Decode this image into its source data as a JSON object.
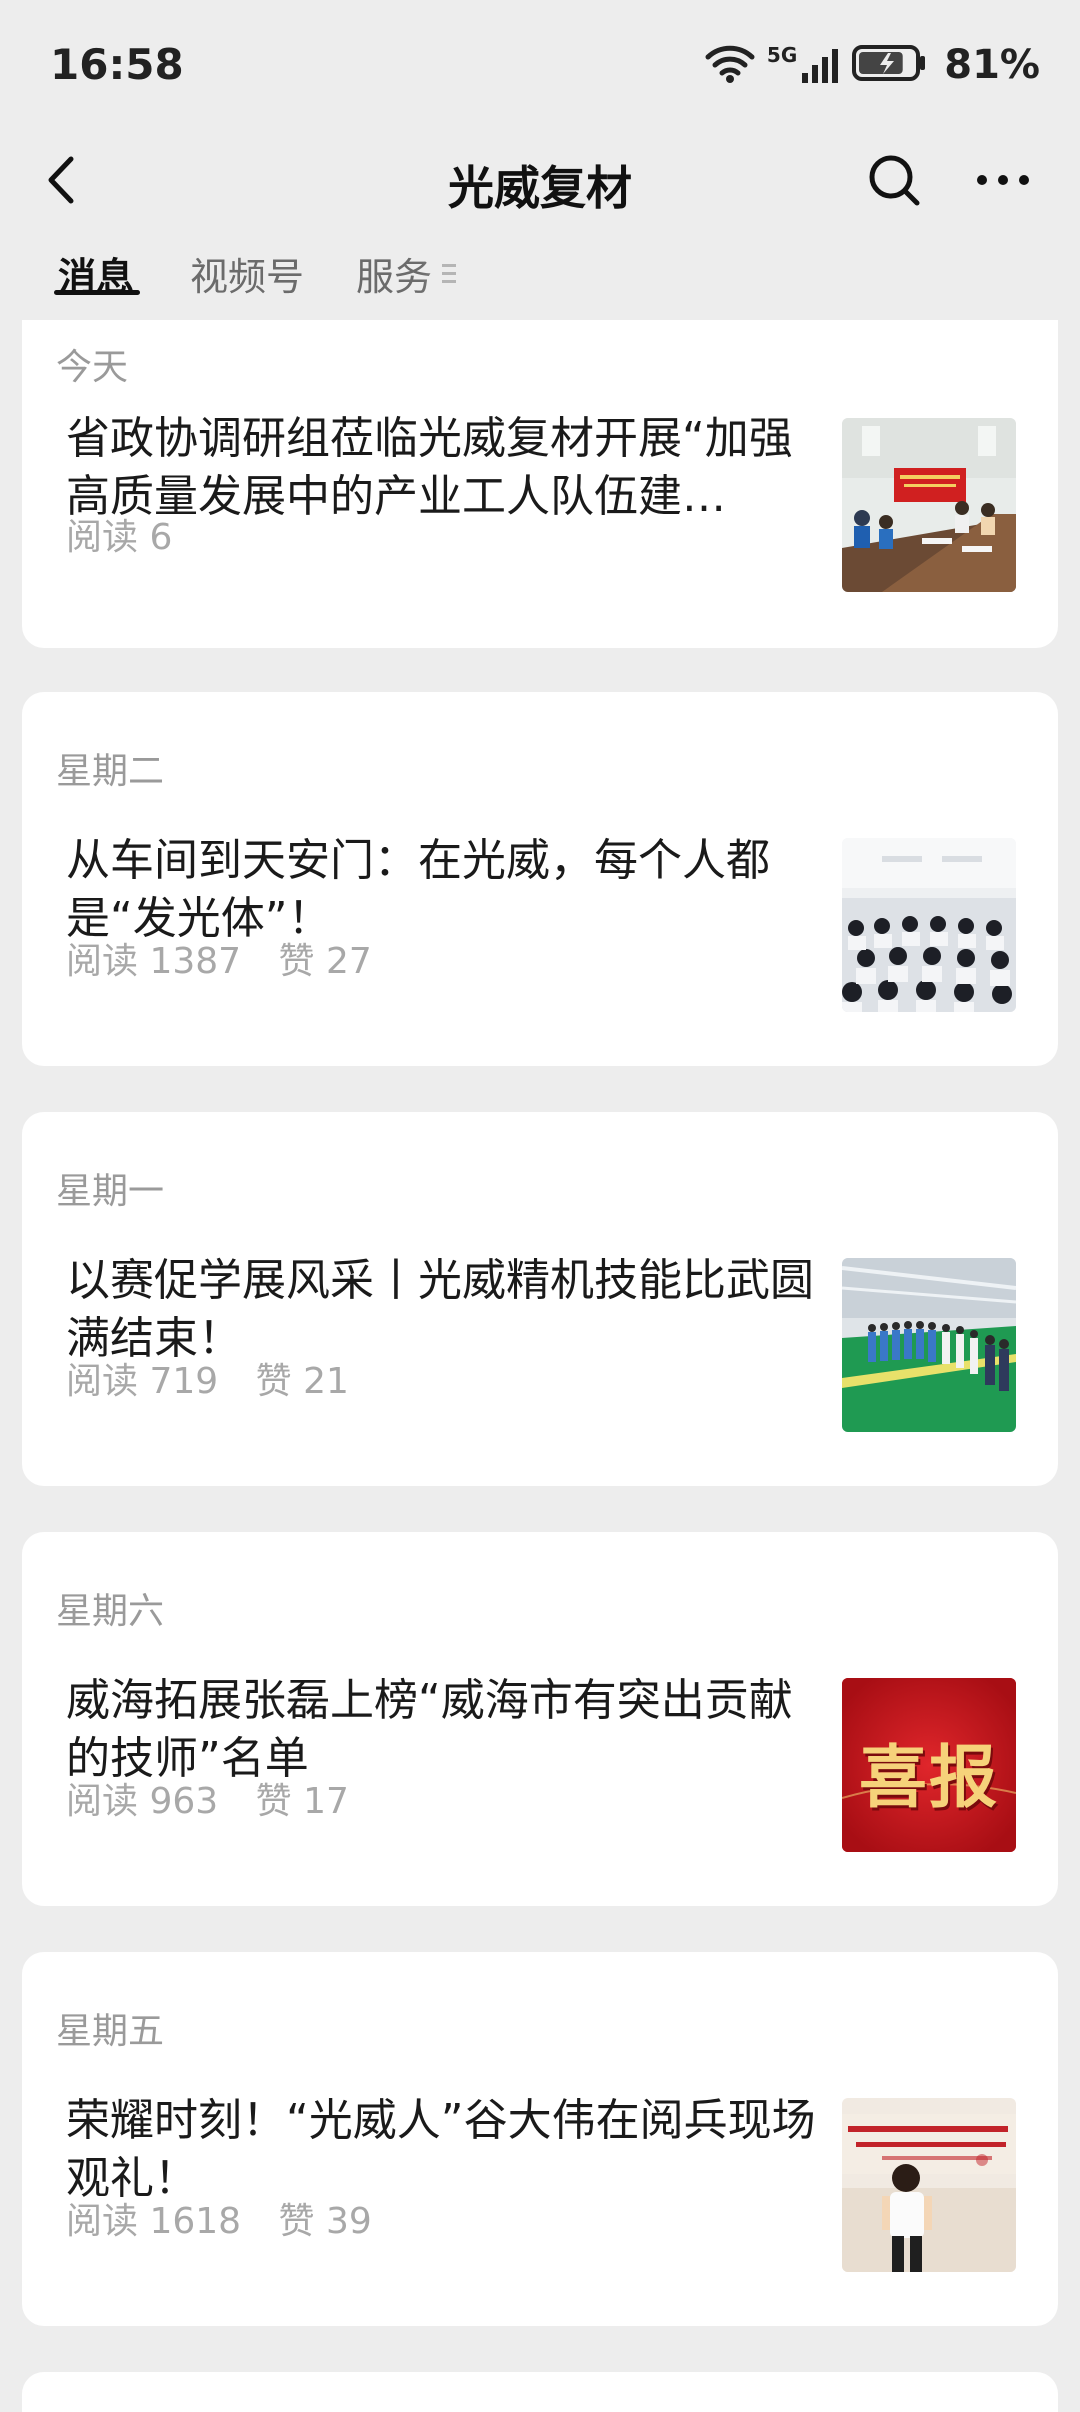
{
  "status_bar": {
    "time": "16:58",
    "network": "5G",
    "battery_percent": "81%",
    "battery_level": 0.81
  },
  "nav": {
    "title": "光威复材",
    "back_icon": "chevron-left-icon",
    "search_icon": "search-icon",
    "more_icon": "more-dots-icon"
  },
  "tabs": [
    {
      "label": "消息",
      "active": true
    },
    {
      "label": "视频号",
      "active": false
    },
    {
      "label": "服务",
      "active": false
    }
  ],
  "articles": [
    {
      "date": "今天",
      "title": "省政协调研组莅临光威复材开展“加强高质量发展中的产业工人队伍建…",
      "reads": "阅读 6",
      "likes": ""
    },
    {
      "date": "星期二",
      "title": "从车间到天安门：在光威，每个人都是“发光体”！",
      "reads": "阅读 1387",
      "likes": "赞 27"
    },
    {
      "date": "星期一",
      "title": "以赛促学展风采丨光威精机技能比武圆满结束！",
      "reads": "阅读 719",
      "likes": "赞 21"
    },
    {
      "date": "星期六",
      "title": "威海拓展张磊上榜“威海市有突出贡献的技师”名单",
      "reads": "阅读 963",
      "likes": "赞 17",
      "thumb_text": "喜报"
    },
    {
      "date": "星期五",
      "title": "荣耀时刻！“光威人”谷大伟在阅兵现场观礼！",
      "reads": "阅读 1618",
      "likes": "赞 39"
    }
  ],
  "colors": {
    "background": "#ededed",
    "card": "#ffffff",
    "muted_text": "#a8a8a8",
    "report_red": "#c8161d"
  }
}
